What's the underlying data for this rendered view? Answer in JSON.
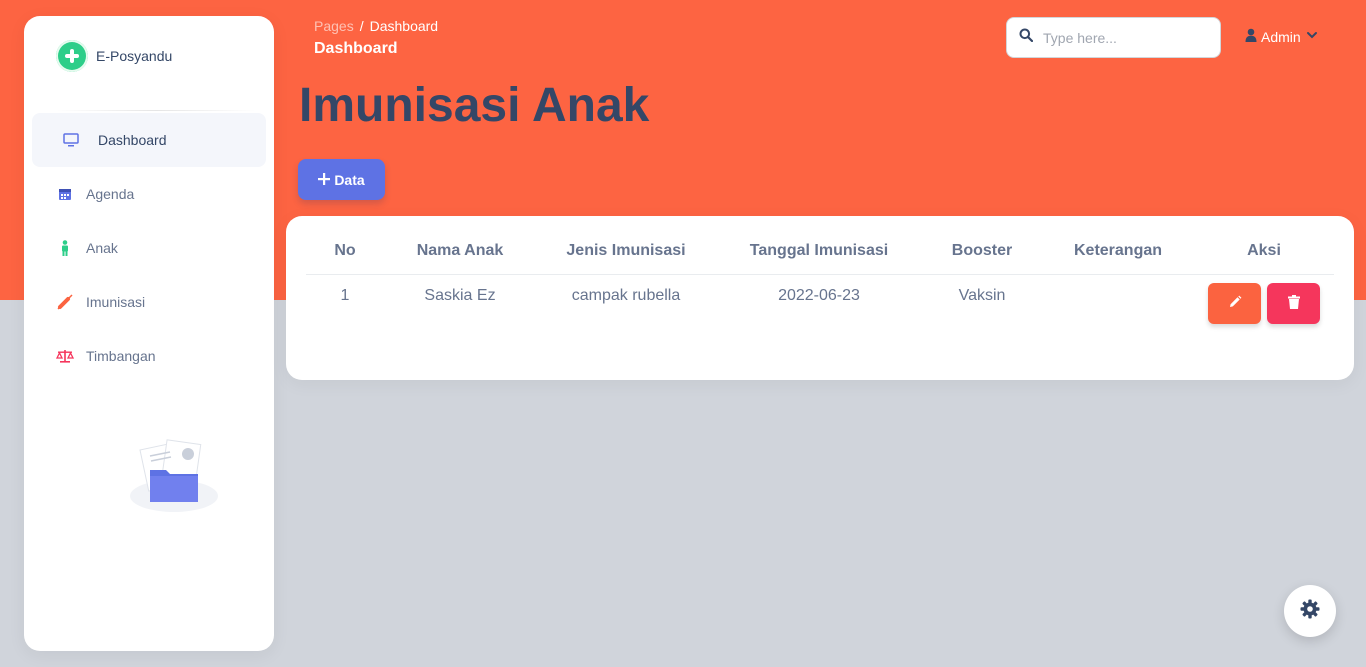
{
  "brand": {
    "name": "E-Posyandu"
  },
  "sidebar": {
    "items": [
      {
        "label": "Dashboard",
        "icon": "monitor-icon",
        "active": true
      },
      {
        "label": "Agenda",
        "icon": "calendar-icon"
      },
      {
        "label": "Anak",
        "icon": "child-icon"
      },
      {
        "label": "Imunisasi",
        "icon": "syringe-icon"
      },
      {
        "label": "Timbangan",
        "icon": "scale-icon"
      }
    ]
  },
  "header": {
    "breadcrumb_root": "Pages",
    "breadcrumb_sep": "/",
    "breadcrumb_current": "Dashboard",
    "page_heading": "Dashboard",
    "search_placeholder": "Type here...",
    "user_label": "Admin"
  },
  "main": {
    "title": "Imunisasi Anak",
    "add_button_label": "Data"
  },
  "table": {
    "columns": [
      "No",
      "Nama Anak",
      "Jenis Imunisasi",
      "Tanggal Imunisasi",
      "Booster",
      "Keterangan",
      "Aksi"
    ],
    "rows": [
      {
        "no": "1",
        "nama": "Saskia Ez",
        "jenis": "campak rubella",
        "tanggal": "2022-06-23",
        "booster": "Vaksin",
        "keterangan": ""
      }
    ]
  },
  "colors": {
    "header_bg": "#fd6442",
    "primary": "#5e72e4",
    "edit": "#fb6340",
    "delete": "#f5365c",
    "brand": "#2dce89"
  }
}
